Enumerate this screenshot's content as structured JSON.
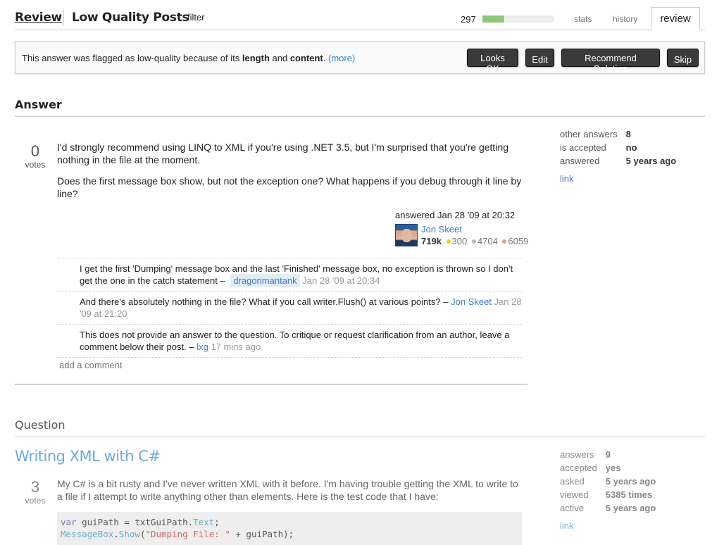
{
  "header": {
    "title_review": "Review",
    "title_queue": "Low Quality Posts",
    "filter_label": "filter",
    "count": "297",
    "progress_percent": 29,
    "tabs": [
      {
        "label": "stats",
        "active": false
      },
      {
        "label": "history",
        "active": false
      },
      {
        "label": "review",
        "active": true
      }
    ]
  },
  "banner": {
    "text_prefix": "This answer was flagged as low-quality because of its ",
    "bold1": "length",
    "text_mid": " and ",
    "bold2": "content",
    "text_suffix": ". ",
    "more_label": "(more)",
    "buttons": {
      "looks_ok": "Looks OK",
      "edit": "Edit",
      "recommend_deletion": "Recommend Deletion",
      "skip": "Skip"
    }
  },
  "answer": {
    "heading": "Answer",
    "votes": "0",
    "votes_label": "votes",
    "paragraphs": [
      "I'd strongly recommend using LINQ to XML if you're using .NET 3.5, but I'm surprised that you're getting nothing in the file at the moment.",
      "Does the first message box show, but not the exception one? What happens if you debug through it line by line?"
    ],
    "signature": {
      "action": "answered Jan 28 '09 at 20:32",
      "user": "Jon Skeet",
      "reputation": "719k",
      "gold": "300",
      "silver": "4704",
      "bronze": "6059"
    },
    "comments": [
      {
        "text": "I get the first 'Dumping' message box and the last 'Finished' message box, no exception is thrown so I don't get the one in the catch statement – ",
        "user": "dragonmantank",
        "date": "Jan 28 '09 at 20:34"
      },
      {
        "text": "And there's absolutely nothing in the file? What if you call writer.Flush() at various points? – ",
        "user": "Jon Skeet",
        "date": "Jan 28 '09 at 21:20"
      },
      {
        "text": "This does not provide an answer to the question. To critique or request clarification from an author, leave a comment below their post. – ",
        "user": "lxg",
        "date": "17 mins ago"
      }
    ],
    "add_comment": "add a comment",
    "stats": [
      {
        "key": "other answers",
        "value": "8"
      },
      {
        "key": "is accepted",
        "value": "no"
      },
      {
        "key": "answered",
        "value": "5 years ago"
      }
    ],
    "link_label": "link"
  },
  "question": {
    "heading": "Question",
    "title": "Writing XML with C#",
    "votes": "3",
    "votes_label": "votes",
    "body": "My C# is a bit rusty and I've never written XML with it before. I'm having trouble getting the XML to write to a file if I attempt to write anything other than elements. Here is the test code that I have:",
    "code": {
      "line1": {
        "kw": "var",
        "a": " guiPath = txtGuiPath.",
        "typ": "Text",
        "b": ";"
      },
      "line2": {
        "typ1": "MessageBox",
        "a": ".",
        "typ2": "Show",
        "b": "(",
        "str": "\"Dumping File: \"",
        "c": " + guiPath);"
      }
    },
    "stats": [
      {
        "key": "answers",
        "value": "9"
      },
      {
        "key": "accepted",
        "value": "yes"
      },
      {
        "key": "asked",
        "value": "5 years ago"
      },
      {
        "key": "viewed",
        "value": "5385 times"
      },
      {
        "key": "active",
        "value": "5 years ago"
      }
    ],
    "link_label": "link"
  }
}
